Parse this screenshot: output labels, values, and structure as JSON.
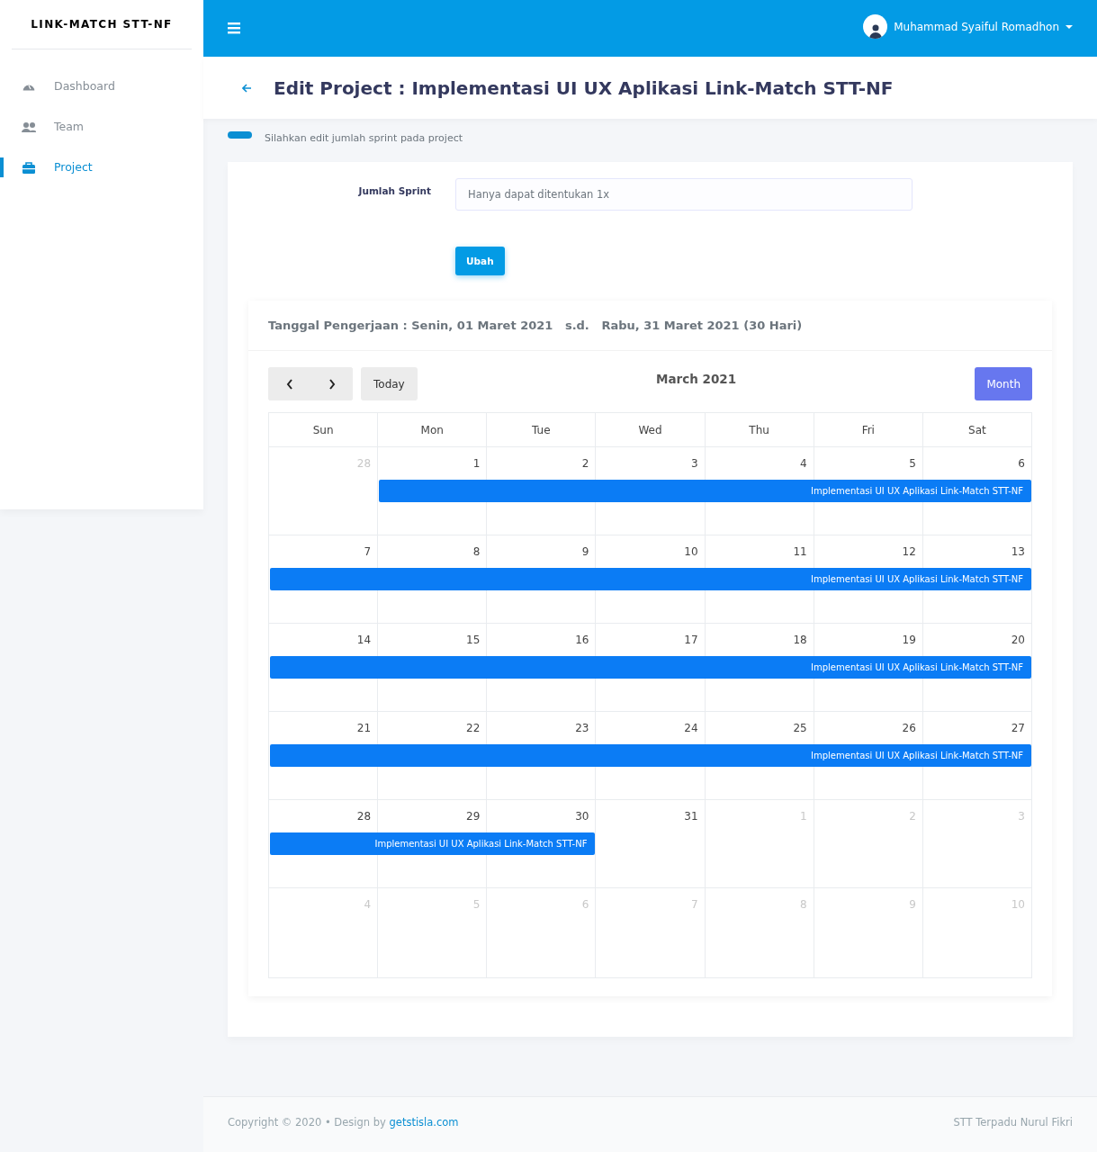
{
  "sidebar": {
    "brand": "LINK-MATCH STT-NF",
    "items": [
      {
        "label": "Dashboard",
        "selected": false
      },
      {
        "label": "Team",
        "selected": false
      },
      {
        "label": "Project",
        "selected": true
      }
    ]
  },
  "topbar": {
    "user_name": "Muhammad Syaiful Romadhon"
  },
  "page_header": {
    "title": "Edit Project : Implementasi UI UX Aplikasi Link-Match STT-NF"
  },
  "notice": "Silahkan edit jumlah sprint pada project",
  "form": {
    "label": "Jumlah Sprint",
    "placeholder": "Hanya dapat ditentukan 1x",
    "button": "Ubah"
  },
  "schedule": {
    "title": "Tanggal Pengerjaan : Senin, 01 Maret 2021   s.d.   Rabu, 31 Maret 2021 (30 Hari)"
  },
  "calendar": {
    "today_button": "Today",
    "month_title": "March 2021",
    "view_button": "Month",
    "columns": [
      "Sun",
      "Mon",
      "Tue",
      "Wed",
      "Thu",
      "Fri",
      "Sat"
    ],
    "weeks": [
      {
        "event": "Implementasi UI UX Aplikasi Link-Match STT-NF",
        "days": [
          {
            "label": "28",
            "other_month": true,
            "in_event": false
          },
          {
            "label": "1",
            "other_month": false,
            "in_event": true
          },
          {
            "label": "2",
            "other_month": false,
            "in_event": true
          },
          {
            "label": "3",
            "other_month": false,
            "in_event": true
          },
          {
            "label": "4",
            "other_month": false,
            "in_event": true
          },
          {
            "label": "5",
            "other_month": false,
            "in_event": true
          },
          {
            "label": "6",
            "other_month": false,
            "in_event": true
          }
        ]
      },
      {
        "event": "Implementasi UI UX Aplikasi Link-Match STT-NF",
        "days": [
          {
            "label": "7",
            "other_month": false,
            "in_event": true
          },
          {
            "label": "8",
            "other_month": false,
            "in_event": true
          },
          {
            "label": "9",
            "other_month": false,
            "in_event": true
          },
          {
            "label": "10",
            "other_month": false,
            "in_event": true
          },
          {
            "label": "11",
            "other_month": false,
            "in_event": true
          },
          {
            "label": "12",
            "other_month": false,
            "in_event": true
          },
          {
            "label": "13",
            "other_month": false,
            "in_event": true
          }
        ]
      },
      {
        "event": "Implementasi UI UX Aplikasi Link-Match STT-NF",
        "days": [
          {
            "label": "14",
            "other_month": false,
            "in_event": true
          },
          {
            "label": "15",
            "other_month": false,
            "in_event": true
          },
          {
            "label": "16",
            "other_month": false,
            "in_event": true
          },
          {
            "label": "17",
            "other_month": false,
            "in_event": true
          },
          {
            "label": "18",
            "other_month": false,
            "in_event": true
          },
          {
            "label": "19",
            "other_month": false,
            "in_event": true
          },
          {
            "label": "20",
            "other_month": false,
            "in_event": true
          }
        ]
      },
      {
        "event": "Implementasi UI UX Aplikasi Link-Match STT-NF",
        "days": [
          {
            "label": "21",
            "other_month": false,
            "in_event": true
          },
          {
            "label": "22",
            "other_month": false,
            "in_event": true
          },
          {
            "label": "23",
            "other_month": false,
            "in_event": true
          },
          {
            "label": "24",
            "other_month": false,
            "in_event": true
          },
          {
            "label": "25",
            "other_month": false,
            "in_event": true
          },
          {
            "label": "26",
            "other_month": false,
            "in_event": true
          },
          {
            "label": "27",
            "other_month": false,
            "in_event": true
          }
        ]
      },
      {
        "event": "Implementasi UI UX Aplikasi Link-Match STT-NF",
        "days": [
          {
            "label": "28",
            "other_month": false,
            "in_event": true
          },
          {
            "label": "29",
            "other_month": false,
            "in_event": true
          },
          {
            "label": "30",
            "other_month": false,
            "in_event": true
          },
          {
            "label": "31",
            "other_month": false,
            "in_event": false
          },
          {
            "label": "1",
            "other_month": true,
            "in_event": false
          },
          {
            "label": "2",
            "other_month": true,
            "in_event": false
          },
          {
            "label": "3",
            "other_month": true,
            "in_event": false
          }
        ]
      },
      {
        "days": [
          {
            "label": "4",
            "other_month": true,
            "in_event": false
          },
          {
            "label": "5",
            "other_month": true,
            "in_event": false
          },
          {
            "label": "6",
            "other_month": true,
            "in_event": false
          },
          {
            "label": "7",
            "other_month": true,
            "in_event": false
          },
          {
            "label": "8",
            "other_month": true,
            "in_event": false
          },
          {
            "label": "9",
            "other_month": true,
            "in_event": false
          },
          {
            "label": "10",
            "other_month": true,
            "in_event": false
          }
        ]
      }
    ]
  },
  "footer": {
    "copyright": "Copyright © 2020",
    "separator": "•",
    "design_by": "Design by",
    "link": "getstisla.com",
    "right": "STT Terpadu Nurul Fikri"
  }
}
